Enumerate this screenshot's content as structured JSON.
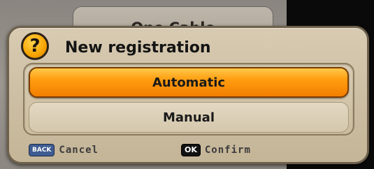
{
  "background": {
    "tab_label": "One Cable"
  },
  "dialog": {
    "icon": "question-icon",
    "icon_glyph": "?",
    "title": "New registration",
    "options": [
      {
        "label": "Automatic",
        "selected": true
      },
      {
        "label": "Manual",
        "selected": false
      }
    ],
    "footer": {
      "cancel_key": "BACK",
      "cancel_label": "Cancel",
      "confirm_key": "OK",
      "confirm_label": "Confirm"
    }
  },
  "colors": {
    "selected_option": "#ff9d10",
    "dialog_background": "#cdbfa4"
  }
}
